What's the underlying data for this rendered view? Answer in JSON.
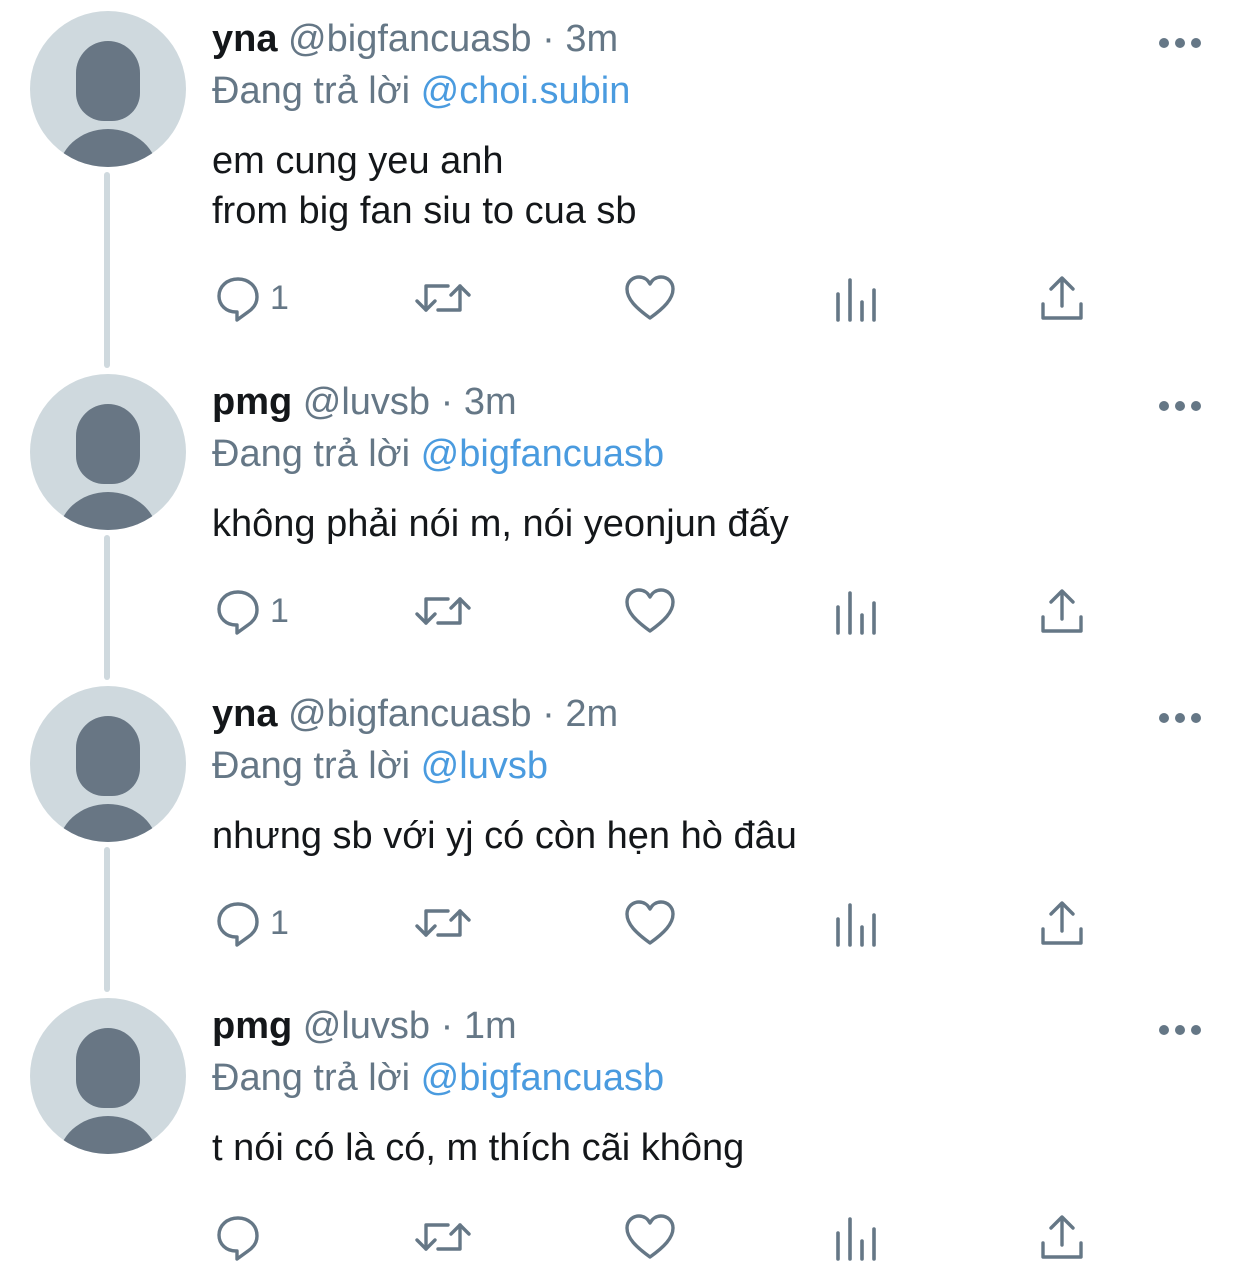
{
  "tweets": [
    {
      "name": "yna",
      "handle": "@bigfancuasb",
      "separator": "·",
      "time": "3m",
      "reply_prefix": "Đang trả lời",
      "reply_to": "@choi.subin",
      "lines": [
        "em cung yeu anh",
        "from big fan siu to cua sb"
      ],
      "reply_count": "1"
    },
    {
      "name": "pmg",
      "handle": "@luvsb",
      "separator": "·",
      "time": "3m",
      "reply_prefix": "Đang trả lời",
      "reply_to": "@bigfancuasb",
      "lines": [
        "không phải nói m, nói yeonjun đấy"
      ],
      "reply_count": "1"
    },
    {
      "name": "yna",
      "handle": "@bigfancuasb",
      "separator": "·",
      "time": "2m",
      "reply_prefix": "Đang trả lời",
      "reply_to": "@luvsb",
      "lines": [
        "nhưng sb với yj có còn hẹn hò đâu"
      ],
      "reply_count": "1"
    },
    {
      "name": "pmg",
      "handle": "@luvsb",
      "separator": "·",
      "time": "1m",
      "reply_prefix": "Đang trả lời",
      "reply_to": "@bigfancuasb",
      "lines": [
        "t nói có là có, m thích cãi không"
      ],
      "reply_count": ""
    }
  ],
  "icons": {
    "reply": "reply-icon",
    "retweet": "retweet-icon",
    "like": "like-icon",
    "analytics": "analytics-icon",
    "share": "share-icon",
    "more": "more-icon",
    "avatar": "default-avatar"
  },
  "colors": {
    "text": "#14171a",
    "secondary": "#657786",
    "mention": "#4a9bdf",
    "avatar_bg": "#cfd9de",
    "avatar_fg": "#687684",
    "thread_line": "#cfd9de"
  }
}
